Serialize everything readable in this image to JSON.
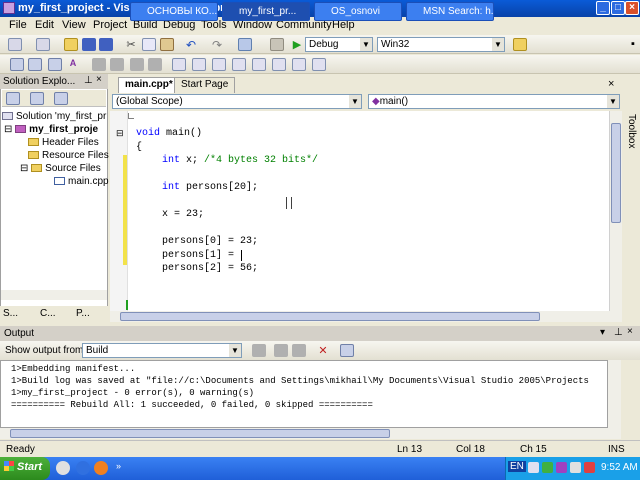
{
  "window": {
    "title": "my_first_project - Visual C++ 2005 Express Edition"
  },
  "menu": [
    "File",
    "Edit",
    "View",
    "Project",
    "Build",
    "Debug",
    "Tools",
    "Window",
    "Community",
    "Help"
  ],
  "toolbar": {
    "config": "Debug",
    "platform": "Win32"
  },
  "solution_explorer": {
    "title": "Solution Explo...",
    "items": [
      "Solution 'my_first_pr",
      "my_first_proje",
      "Header Files",
      "Resource Files",
      "Source Files",
      "main.cpp"
    ],
    "bottom_tabs": [
      "S...",
      "C...",
      "P..."
    ]
  },
  "editor": {
    "tabs": [
      "main.cpp*",
      "Start Page"
    ],
    "scope": "(Global Scope)",
    "function": "main()",
    "lines": {
      "l1_kw": "void",
      "l1_rest": " main()",
      "brace": "{",
      "l3_kw": "int",
      "l3_rest": " x; ",
      "l3_cm": "/*4 bytes 32 bits*/",
      "l4_kw": "int",
      "l4_rest": " persons[20];",
      "l5": "x = 23;",
      "l6": "persons[0] = 23;",
      "l7": "persons[1] = ",
      "l8": "persons[2] = 56;"
    },
    "toolbox_label": "Toolbox"
  },
  "output": {
    "title": "Output",
    "show_label": "Show output from:",
    "source": "Build",
    "lines": [
      "1>Embedding manifest...",
      "1>Build log was saved at \"file://c:\\Documents and Settings\\mikhail\\My Documents\\Visual Studio 2005\\Projects",
      "1>my_first_project - 0 error(s), 0 warning(s)",
      "========== Rebuild All: 1 succeeded, 0 failed, 0 skipped =========="
    ]
  },
  "status": {
    "text": "Ready",
    "ln": "Ln 13",
    "col": "Col 18",
    "ch": "Ch 15",
    "ins": "INS"
  },
  "taskbar": {
    "start": "Start",
    "tasks": [
      "ОСНОВЫ КО...",
      "my_first_pr...",
      "OS_osnovi",
      "MSN Search: h..."
    ],
    "lang": "EN",
    "time": "9:52 AM"
  },
  "colors": {
    "keyword": "#0000ff",
    "comment": "#008000",
    "title_bar": "#0a5bd7",
    "taskbar": "#245edb"
  }
}
